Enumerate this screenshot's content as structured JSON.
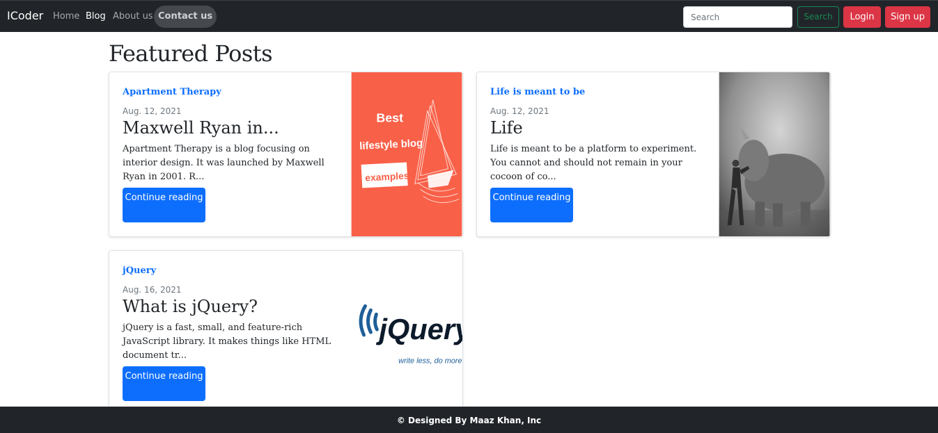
{
  "nav": {
    "brand": "ICoder",
    "links": [
      "Home",
      "Blog",
      "About us",
      "Contact us"
    ],
    "search_placeholder": "Search",
    "search_button": "Search",
    "login": "Login",
    "signup": "Sign up"
  },
  "main": {
    "title": "Featured Posts",
    "posts": [
      {
        "category": "Apartment Therapy",
        "date": "Aug. 12, 2021",
        "title": "Maxwell Ryan in...",
        "excerpt": "Apartment Therapy is a blog focusing on interior design. It was launched by Maxwell Ryan in 2001. R...",
        "button": "Continue reading",
        "image_text": [
          "Best",
          "lifestyle blog",
          "examples"
        ]
      },
      {
        "category": "Life is meant to be",
        "date": "Aug. 12, 2021",
        "title": "Life",
        "excerpt": "Life is meant to be a platform to experiment. You cannot and should not remain in your cocoon of co...",
        "button": "Continue reading"
      },
      {
        "category": "jQuery",
        "date": "Aug. 16, 2021",
        "title": "What is jQuery?",
        "excerpt": "jQuery is a fast, small, and feature-rich JavaScript library. It makes things like HTML document tr...",
        "button": "Continue reading",
        "image_text": [
          "jQuery",
          "write less, do more."
        ]
      }
    ]
  },
  "footer": {
    "text": "© Designed By Maaz Khan, Inc"
  },
  "colors": {
    "navbar": "#212529",
    "primary": "#0d6efd",
    "danger": "#dc3545",
    "success": "#198754",
    "accent_orange": "#f96048"
  }
}
